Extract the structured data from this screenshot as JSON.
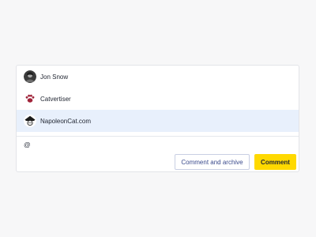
{
  "mentions": {
    "items": [
      {
        "name": "Jon Snow",
        "avatar_icon": "person-photo-icon"
      },
      {
        "name": "Catvertiser",
        "avatar_icon": "paw-logo-icon"
      },
      {
        "name": "NapoleonCat.com",
        "avatar_icon": "napoleoncat-logo-icon",
        "highlighted": true
      }
    ]
  },
  "composer": {
    "input_value": "@"
  },
  "actions": {
    "archive_label": "Comment and archive",
    "comment_label": "Comment"
  },
  "colors": {
    "highlight": "#e8f0fc",
    "primary_button": "#ffd900",
    "secondary_button_text": "#3a4a8c"
  }
}
